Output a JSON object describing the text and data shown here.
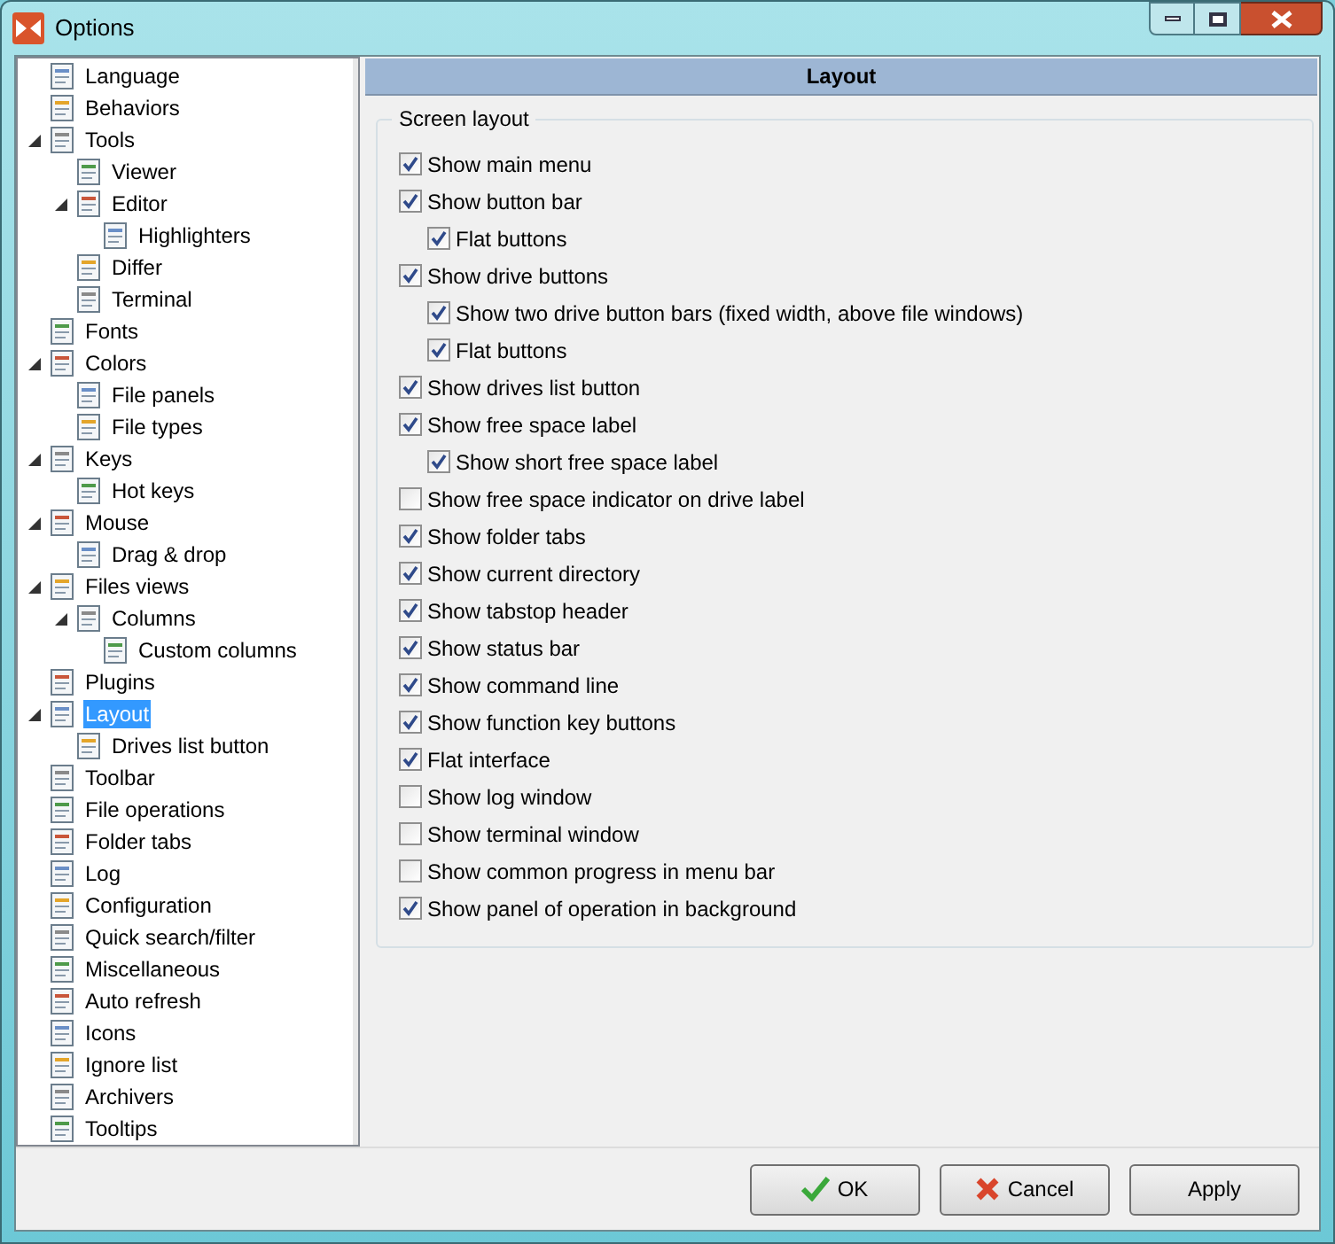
{
  "window": {
    "title": "Options"
  },
  "tree": [
    {
      "label": "Language",
      "selected": false
    },
    {
      "label": "Behaviors",
      "selected": false
    },
    {
      "label": "Tools",
      "selected": false,
      "expanded": true,
      "children": [
        {
          "label": "Viewer",
          "selected": false
        },
        {
          "label": "Editor",
          "selected": false,
          "expanded": true,
          "children": [
            {
              "label": "Highlighters",
              "selected": false
            }
          ]
        },
        {
          "label": "Differ",
          "selected": false
        },
        {
          "label": "Terminal",
          "selected": false
        }
      ]
    },
    {
      "label": "Fonts",
      "selected": false
    },
    {
      "label": "Colors",
      "selected": false,
      "expanded": true,
      "children": [
        {
          "label": "File panels",
          "selected": false
        },
        {
          "label": "File types",
          "selected": false
        }
      ]
    },
    {
      "label": "Keys",
      "selected": false,
      "expanded": true,
      "children": [
        {
          "label": "Hot keys",
          "selected": false
        }
      ]
    },
    {
      "label": "Mouse",
      "selected": false,
      "expanded": true,
      "children": [
        {
          "label": "Drag & drop",
          "selected": false
        }
      ]
    },
    {
      "label": "Files views",
      "selected": false,
      "expanded": true,
      "children": [
        {
          "label": "Columns",
          "selected": false,
          "expanded": true,
          "children": [
            {
              "label": "Custom columns",
              "selected": false
            }
          ]
        }
      ]
    },
    {
      "label": "Plugins",
      "selected": false
    },
    {
      "label": "Layout",
      "selected": true,
      "expanded": true,
      "children": [
        {
          "label": "Drives list button",
          "selected": false
        }
      ]
    },
    {
      "label": "Toolbar",
      "selected": false
    },
    {
      "label": "File operations",
      "selected": false
    },
    {
      "label": "Folder tabs",
      "selected": false
    },
    {
      "label": "Log",
      "selected": false
    },
    {
      "label": "Configuration",
      "selected": false
    },
    {
      "label": "Quick search/filter",
      "selected": false
    },
    {
      "label": "Miscellaneous",
      "selected": false
    },
    {
      "label": "Auto refresh",
      "selected": false
    },
    {
      "label": "Icons",
      "selected": false
    },
    {
      "label": "Ignore list",
      "selected": false
    },
    {
      "label": "Archivers",
      "selected": false
    },
    {
      "label": "Tooltips",
      "selected": false
    }
  ],
  "panel": {
    "title": "Layout",
    "group": "Screen layout",
    "options": [
      {
        "label": "Show main menu",
        "checked": true
      },
      {
        "label": "Show button bar",
        "checked": true,
        "children": [
          {
            "label": "Flat buttons",
            "checked": true
          }
        ]
      },
      {
        "label": "Show drive buttons",
        "checked": true,
        "children": [
          {
            "label": "Show two drive button bars (fixed width, above file windows)",
            "checked": true
          },
          {
            "label": "Flat buttons",
            "checked": true
          }
        ]
      },
      {
        "label": "Show drives list button",
        "checked": true
      },
      {
        "label": "Show free space label",
        "checked": true,
        "children": [
          {
            "label": "Show short free space label",
            "checked": true
          }
        ]
      },
      {
        "label": "Show free space indicator on drive label",
        "checked": false
      },
      {
        "label": "Show folder tabs",
        "checked": true
      },
      {
        "label": "Show current directory",
        "checked": true
      },
      {
        "label": "Show tabstop header",
        "checked": true
      },
      {
        "label": "Show status bar",
        "checked": true
      },
      {
        "label": "Show command line",
        "checked": true
      },
      {
        "label": "Show function key buttons",
        "checked": true
      },
      {
        "label": "Flat interface",
        "checked": true
      },
      {
        "label": "Show log window",
        "checked": false
      },
      {
        "label": "Show terminal window",
        "checked": false
      },
      {
        "label": "Show common progress in menu bar",
        "checked": false
      },
      {
        "label": "Show panel of operation in background",
        "checked": true
      }
    ]
  },
  "buttons": [
    {
      "label": "OK",
      "kind": "ok"
    },
    {
      "label": "Cancel",
      "kind": "cancel"
    },
    {
      "label": "Apply",
      "kind": "plain"
    }
  ]
}
